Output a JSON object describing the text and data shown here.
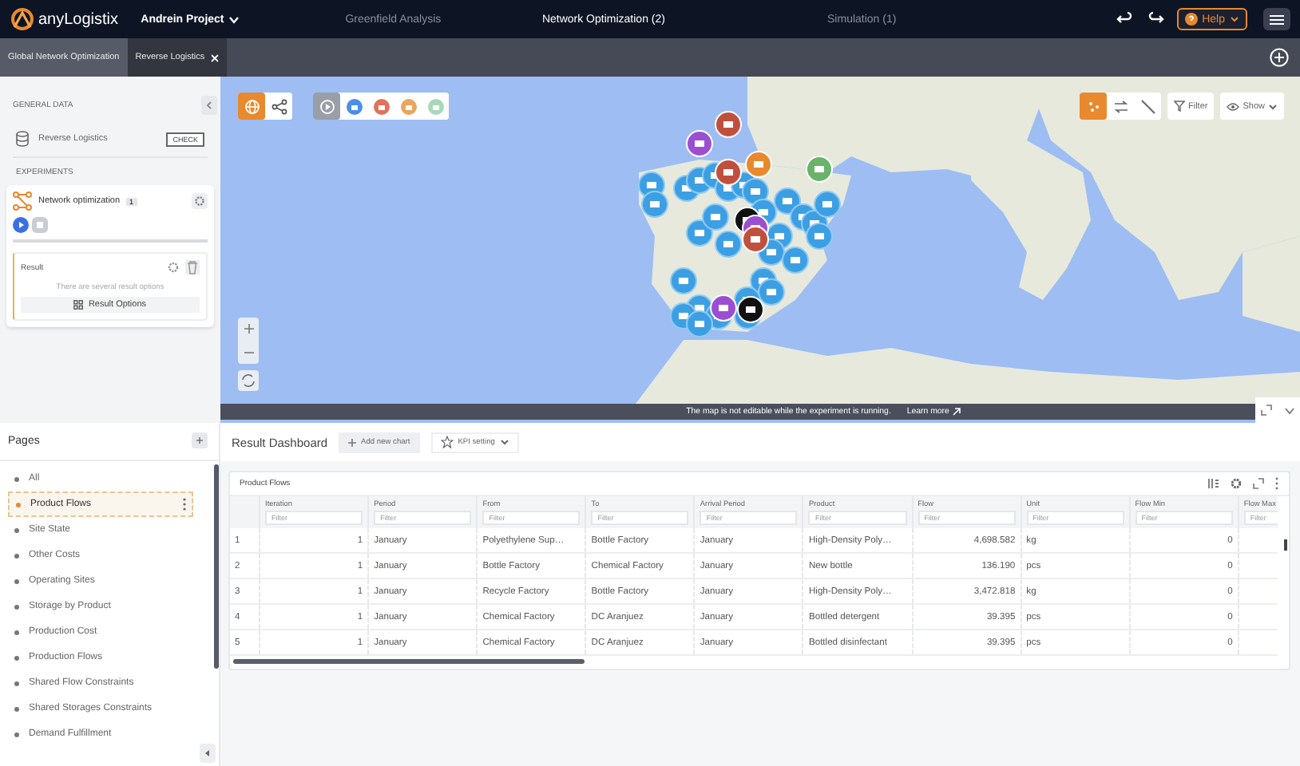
{
  "app_bar": {
    "logo": "anyLogistix",
    "project": "Andrein Project",
    "tabs": [
      {
        "label": "Greenfield Analysis",
        "selected": false
      },
      {
        "label": "Network Optimization (2)",
        "selected": true
      },
      {
        "label": "Simulation (1)",
        "selected": false
      }
    ],
    "help": "Help"
  },
  "doc_tabs": [
    {
      "label": "Global Network Optimization",
      "selected": false,
      "closable": false
    },
    {
      "label": "Reverse Logistics",
      "selected": true,
      "closable": true
    }
  ],
  "left_panel": {
    "general_heading": "GENERAL DATA",
    "scenario": {
      "name": "Reverse Logistics",
      "action": "CHECK"
    },
    "experiments_heading": "EXPERIMENTS",
    "experiment": {
      "name": "Network optimization",
      "count": "1",
      "running": true
    },
    "result": {
      "title": "Result",
      "hint": "There are several result options",
      "button": "Result Options"
    }
  },
  "map": {
    "layer_modes": [
      {
        "kind": "globe",
        "selected": true
      },
      {
        "kind": "graph",
        "selected": false
      }
    ],
    "object_filters": [
      {
        "kind": "cursor",
        "color": "#9a9ea6"
      },
      {
        "kind": "site",
        "color": "#4a8ee8"
      },
      {
        "kind": "site",
        "color": "#e0715a"
      },
      {
        "kind": "site",
        "color": "#eaa55e"
      },
      {
        "kind": "site",
        "color": "#a8d8b8"
      }
    ],
    "view_modes": [
      {
        "kind": "points",
        "selected": true
      },
      {
        "kind": "flows",
        "selected": false
      },
      {
        "kind": "lines",
        "selected": false
      }
    ],
    "filter": "Filter",
    "show": "Show",
    "notice": "The map is not editable while the experiment is running.",
    "link": "Learn more"
  },
  "pages": {
    "title": "Pages",
    "items": [
      {
        "label": "All",
        "selected": false
      },
      {
        "label": "Product Flows",
        "selected": true
      },
      {
        "label": "Site State",
        "selected": false
      },
      {
        "label": "Other Costs",
        "selected": false
      },
      {
        "label": "Operating Sites",
        "selected": false
      },
      {
        "label": "Storage by Product",
        "selected": false
      },
      {
        "label": "Production Cost",
        "selected": false
      },
      {
        "label": "Production Flows",
        "selected": false
      },
      {
        "label": "Shared Flow Constraints",
        "selected": false
      },
      {
        "label": "Shared Storages Constraints",
        "selected": false
      },
      {
        "label": "Demand Fulfillment",
        "selected": false
      }
    ]
  },
  "dashboard": {
    "title": "Result Dashboard",
    "add_chart": "Add new chart",
    "kpi": "KPI setting",
    "widget": {
      "title": "Product Flows",
      "columns": [
        {
          "label": "Iteration",
          "kind": "number",
          "placeholder": "Filter"
        },
        {
          "label": "Period",
          "kind": "text",
          "placeholder": "Filter"
        },
        {
          "label": "From",
          "kind": "text",
          "placeholder": "Filter"
        },
        {
          "label": "To",
          "kind": "text",
          "placeholder": "Filter"
        },
        {
          "label": "Arrival Period",
          "kind": "text",
          "placeholder": "Filter"
        },
        {
          "label": "Product",
          "kind": "text",
          "placeholder": "Filter"
        },
        {
          "label": "Flow",
          "kind": "number",
          "placeholder": "Filter"
        },
        {
          "label": "Unit",
          "kind": "text",
          "placeholder": "Filter"
        },
        {
          "label": "Flow Min",
          "kind": "number",
          "placeholder": "Filter"
        },
        {
          "label": "Flow Max",
          "kind": "number",
          "placeholder": "Filter"
        }
      ],
      "rows": [
        {
          "number": "1",
          "cells": [
            "1",
            "January",
            "Polyethylene Sup…",
            "Bottle Factory",
            "January",
            "High-Density Poly…",
            "4,698.582",
            "kg",
            "0"
          ]
        },
        {
          "number": "2",
          "cells": [
            "1",
            "January",
            "Bottle Factory",
            "Chemical Factory",
            "January",
            "New bottle",
            "136.190",
            "pcs",
            "0"
          ]
        },
        {
          "number": "3",
          "cells": [
            "1",
            "January",
            "Recycle Factory",
            "Bottle Factory",
            "January",
            "High-Density Poly…",
            "3,472.818",
            "kg",
            "0"
          ]
        },
        {
          "number": "4",
          "cells": [
            "1",
            "January",
            "Chemical Factory",
            "DC Aranjuez",
            "January",
            "Bottled detergent",
            "39.395",
            "pcs",
            "0"
          ]
        },
        {
          "number": "5",
          "cells": [
            "1",
            "January",
            "Chemical Factory",
            "DC Aranjuez",
            "January",
            "Bottled disinfectant",
            "39.395",
            "pcs",
            "0"
          ]
        }
      ]
    }
  }
}
